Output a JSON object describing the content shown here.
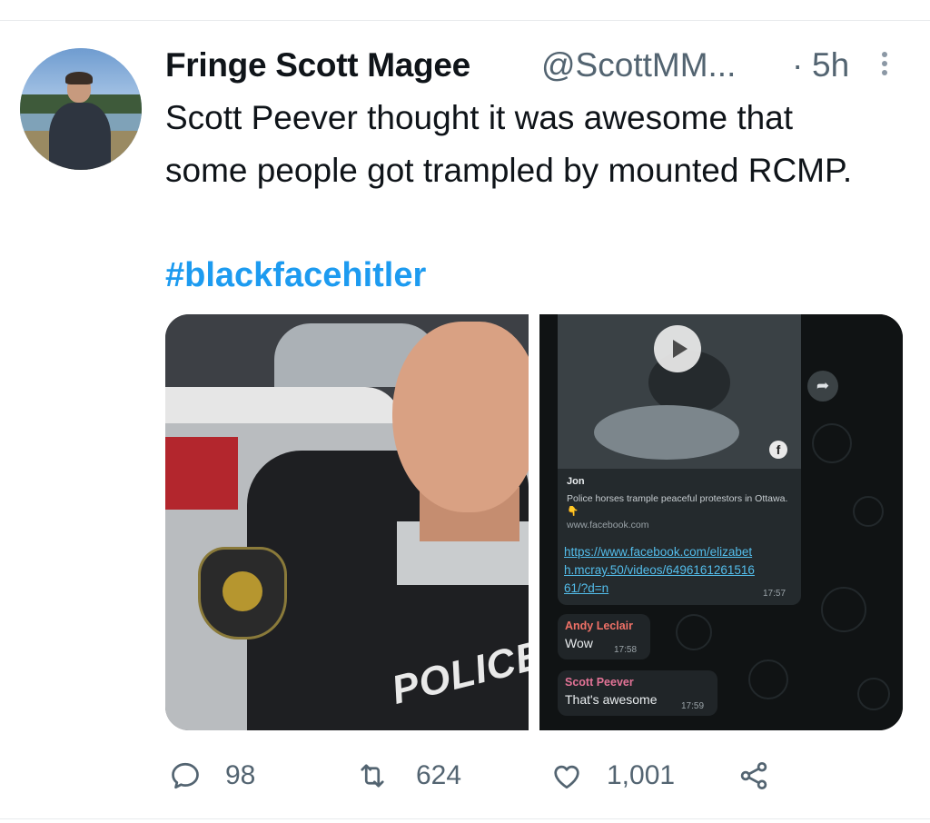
{
  "tweet": {
    "display_name": "Fringe Scott Magee",
    "handle": "@ScottMM...",
    "separator": "·",
    "time": "5h",
    "text": "Scott Peever thought it was awesome that some people got trampled by mounted RCMP.",
    "hashtag": "#blackfacehitler",
    "accent_color": "#1d9bf0"
  },
  "media": {
    "left_photo": {
      "vest_text": "POLICE"
    },
    "chat": {
      "link_preview": {
        "name": "Jon",
        "description": "Police horses trample peaceful protestors in Ottawa. 👇",
        "domain": "www.facebook.com",
        "fb_glyph": "f"
      },
      "link_message": {
        "url": "https://www.facebook.com/elizabeth.mcray.50/videos/649616126151661/?d=n",
        "time": "17:57"
      },
      "messages": [
        {
          "sender": "Andy Leclair",
          "text": "Wow",
          "time": "17:58",
          "sender_color": "#f07167"
        },
        {
          "sender": "Scott Peever",
          "text": "That's awesome",
          "time": "17:59",
          "sender_color": "#e27396"
        }
      ]
    }
  },
  "actions": {
    "reply_count": "98",
    "retweet_count": "624",
    "like_count": "1,001"
  }
}
